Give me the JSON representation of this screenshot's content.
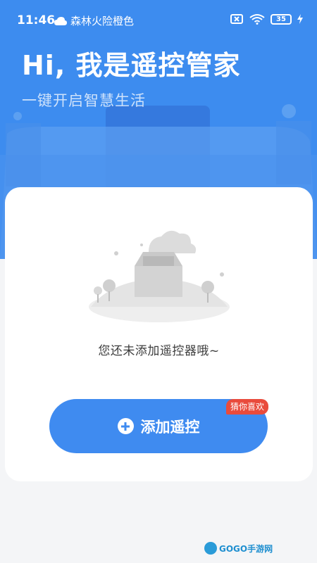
{
  "status_bar": {
    "time": "11:46",
    "weather": "森林火险橙色",
    "battery": "35"
  },
  "hero": {
    "title": "Hi, 我是遥控管家",
    "subtitle": "一键开启智慧生活"
  },
  "empty_state": {
    "message": "您还未添加遥控器哦~"
  },
  "add_button": {
    "label": "添加遥控",
    "badge": "猜你喜欢"
  },
  "watermark": {
    "text": "GOGO手游网"
  },
  "colors": {
    "primary": "#3f8bf0",
    "badge": "#e94b3c",
    "background": "#f4f5f7"
  }
}
